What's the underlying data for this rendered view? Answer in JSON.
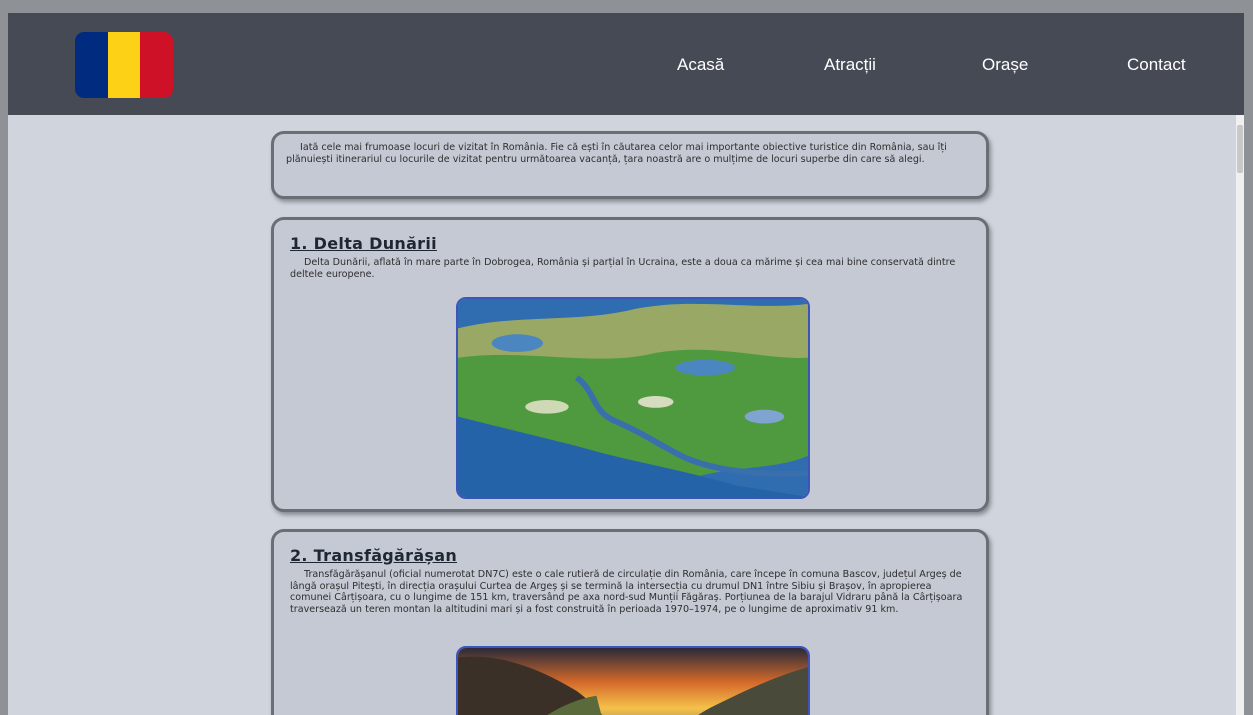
{
  "nav": {
    "links": [
      "Acasă",
      "Atracții",
      "Orașe",
      "Contact"
    ]
  },
  "flag": {
    "colors": [
      "#002b7f",
      "#fcd116",
      "#ce1126"
    ]
  },
  "intro": {
    "text": "Iată cele mai frumoase locuri de vizitat în România. Fie că ești în căutarea celor mai importante obiective turistice din România, sau îți plănuiești itinerariul cu locurile de vizitat pentru următoarea vacanță, țara noastră are o mulțime de locuri superbe din care să alegi."
  },
  "sections": [
    {
      "title": "1. Delta Dunării",
      "text": "Delta Dunării, aflată în mare parte în Dobrogea, România și parțial în Ucraina, este a doua ca mărime și cea mai bine conservată dintre deltele europene."
    },
    {
      "title": "2. Transfăgărășan",
      "text": "Transfăgărășanul (oficial numerotat DN7C) este o cale rutieră de circulație din România, care începe în comuna Bascov, județul Argeș de lângă orașul Pitești, în direcția orașului Curtea de Argeș și se termină la intersecția cu drumul DN1 între Sibiu și Brașov, în apropierea comunei Cârțișoara, cu o lungime de 151 km, traversând pe axa nord-sud Munții Făgăraș. Porțiunea de la barajul Vidraru până la Cârțișoara traversează un teren montan la altitudini mari și a fost construită în perioada 1970–1974, pe o lungime de aproximativ 91 km."
    }
  ]
}
